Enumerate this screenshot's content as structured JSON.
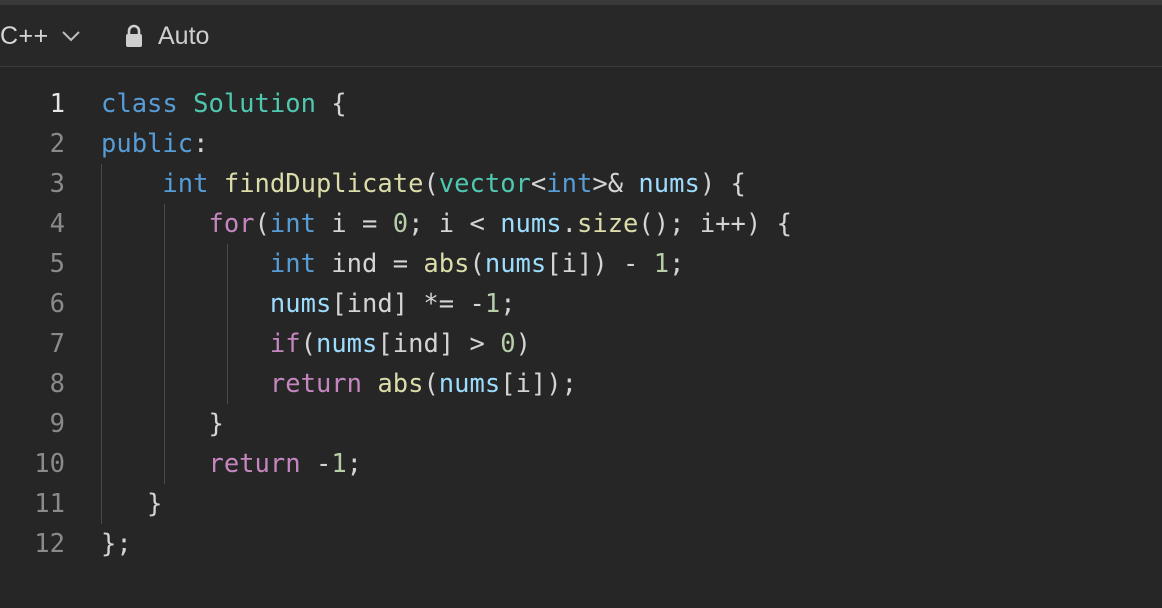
{
  "toolbar": {
    "language": "C++",
    "mode": "Auto",
    "icons": {
      "language_dropdown": "chevron-down-icon",
      "mode": "lock-icon"
    }
  },
  "editor": {
    "active_line": 1,
    "lines": [
      {
        "number": "1",
        "tokens": [
          [
            "kw",
            "class"
          ],
          [
            "pn",
            " "
          ],
          [
            "ty",
            "Solution"
          ],
          [
            "pn",
            " {"
          ]
        ]
      },
      {
        "number": "2",
        "tokens": [
          [
            "kw",
            "public"
          ],
          [
            "pn",
            ":"
          ]
        ]
      },
      {
        "number": "3",
        "tokens": [
          [
            "pn",
            "    "
          ],
          [
            "kw",
            "int"
          ],
          [
            "pn",
            " "
          ],
          [
            "fn",
            "findDuplicate"
          ],
          [
            "pn",
            "("
          ],
          [
            "ty",
            "vector"
          ],
          [
            "pn",
            "<"
          ],
          [
            "kw",
            "int"
          ],
          [
            "pn",
            ">& "
          ],
          [
            "var",
            "nums"
          ],
          [
            "pn",
            ") {"
          ]
        ]
      },
      {
        "number": "4",
        "tokens": [
          [
            "pn",
            "       "
          ],
          [
            "ctl",
            "for"
          ],
          [
            "pn",
            "("
          ],
          [
            "kw",
            "int"
          ],
          [
            "pn",
            " i = "
          ],
          [
            "num",
            "0"
          ],
          [
            "pn",
            "; i < "
          ],
          [
            "var",
            "nums"
          ],
          [
            "pn",
            "."
          ],
          [
            "fn",
            "size"
          ],
          [
            "pn",
            "(); i++) {"
          ]
        ]
      },
      {
        "number": "5",
        "tokens": [
          [
            "pn",
            "           "
          ],
          [
            "kw",
            "int"
          ],
          [
            "pn",
            " ind = "
          ],
          [
            "fn",
            "abs"
          ],
          [
            "pn",
            "("
          ],
          [
            "var",
            "nums"
          ],
          [
            "pn",
            "[i]) - "
          ],
          [
            "num",
            "1"
          ],
          [
            "pn",
            ";"
          ]
        ]
      },
      {
        "number": "6",
        "tokens": [
          [
            "pn",
            "           "
          ],
          [
            "var",
            "nums"
          ],
          [
            "pn",
            "[ind] *= -"
          ],
          [
            "num",
            "1"
          ],
          [
            "pn",
            ";"
          ]
        ]
      },
      {
        "number": "7",
        "tokens": [
          [
            "pn",
            "           "
          ],
          [
            "ctl",
            "if"
          ],
          [
            "pn",
            "("
          ],
          [
            "var",
            "nums"
          ],
          [
            "pn",
            "[ind] > "
          ],
          [
            "num",
            "0"
          ],
          [
            "pn",
            ")"
          ]
        ]
      },
      {
        "number": "8",
        "tokens": [
          [
            "pn",
            "           "
          ],
          [
            "ctl",
            "return"
          ],
          [
            "pn",
            " "
          ],
          [
            "fn",
            "abs"
          ],
          [
            "pn",
            "("
          ],
          [
            "var",
            "nums"
          ],
          [
            "pn",
            "[i]);"
          ]
        ]
      },
      {
        "number": "9",
        "tokens": [
          [
            "pn",
            "       }"
          ]
        ]
      },
      {
        "number": "10",
        "tokens": [
          [
            "pn",
            "       "
          ],
          [
            "ctl",
            "return"
          ],
          [
            "pn",
            " -"
          ],
          [
            "num",
            "1"
          ],
          [
            "pn",
            ";"
          ]
        ]
      },
      {
        "number": "11",
        "tokens": [
          [
            "pn",
            "   }"
          ]
        ]
      },
      {
        "number": "12",
        "tokens": [
          [
            "pn",
            "};"
          ]
        ]
      }
    ]
  }
}
